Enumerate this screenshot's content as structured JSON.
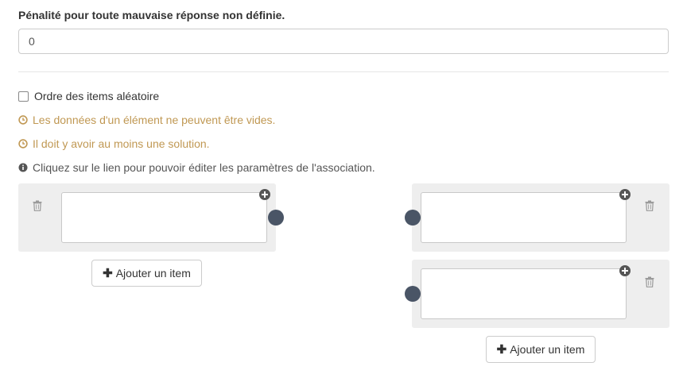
{
  "penalty": {
    "label": "Pénalité pour toute mauvaise réponse non définie.",
    "value": "0"
  },
  "options": {
    "shuffle_label": "Ordre des items aléatoire",
    "shuffle_checked": false
  },
  "messages": [
    {
      "type": "warning",
      "icon": "clock-icon",
      "text": "Les données d'un élément ne peuvent être vides."
    },
    {
      "type": "warning",
      "icon": "clock-icon",
      "text": "Il doit y avoir au moins une solution."
    },
    {
      "type": "info",
      "icon": "info-circle-icon",
      "text": "Cliquez sur le lien pour pouvoir éditer les paramètres de l'association."
    }
  ],
  "left_column": {
    "items": [
      {
        "value": ""
      }
    ],
    "add_label": "Ajouter un item"
  },
  "right_column": {
    "items": [
      {
        "value": ""
      },
      {
        "value": ""
      }
    ],
    "add_label": "Ajouter un item"
  },
  "colors": {
    "warning": "#c09853",
    "connector": "#4a5566",
    "panel": "#eeeeee"
  }
}
